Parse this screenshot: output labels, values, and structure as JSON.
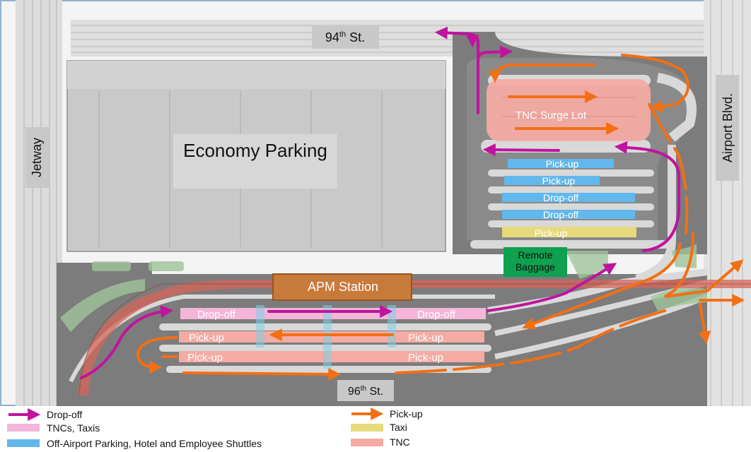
{
  "map": {
    "labels": {
      "street_94": "94",
      "street_94_sup": "th",
      "street_94_suffix": " St.",
      "street_96": "96",
      "street_96_sup": "th",
      "street_96_suffix": " St.",
      "jetway": "Jetway",
      "airport_blvd": "Airport Blvd.",
      "economy_parking": "Economy Parking",
      "tnc_surge_lot": "TNC Surge Lot",
      "apm_station": "APM Station",
      "remote_baggage_line1": "Remote",
      "remote_baggage_line2": "Baggage"
    },
    "lanes_east": [
      {
        "label": "Pick-up",
        "kind": "shuttle"
      },
      {
        "label": "Pick-up",
        "kind": "shuttle"
      },
      {
        "label": "Drop-off",
        "kind": "shuttle"
      },
      {
        "label": "Drop-off",
        "kind": "shuttle"
      },
      {
        "label": "Pick-up",
        "kind": "taxi"
      }
    ],
    "lanes_south": [
      {
        "left": "Drop-off",
        "right": "Drop-off",
        "kind": "tnc_taxi"
      },
      {
        "left": "Pick-up",
        "right": "Pick-up",
        "kind": "tnc"
      },
      {
        "left": "Pick-up",
        "right": "Pick-up",
        "kind": "tnc"
      }
    ]
  },
  "legend": {
    "dropoff_arrow": "Drop-off",
    "tnc_taxis": "TNCs, Taxis",
    "shuttles": "Off-Airport Parking, Hotel and Employee Shuttles",
    "pickup_arrow": "Pick-up",
    "taxi": "Taxi",
    "tnc": "TNC"
  },
  "colors": {
    "dropoff_arrow": "#c0139e",
    "pickup_arrow": "#f36f13",
    "tnc_taxi_zone": "#f4b6d8",
    "shuttle_zone": "#62b8ec",
    "taxi_zone": "#e6da7c",
    "tnc_zone": "#f3aba3",
    "apm_station": "#c87a3a",
    "remote_baggage": "#0fa050",
    "road": "#7c7c7c",
    "lot": "#c9c9c9"
  }
}
